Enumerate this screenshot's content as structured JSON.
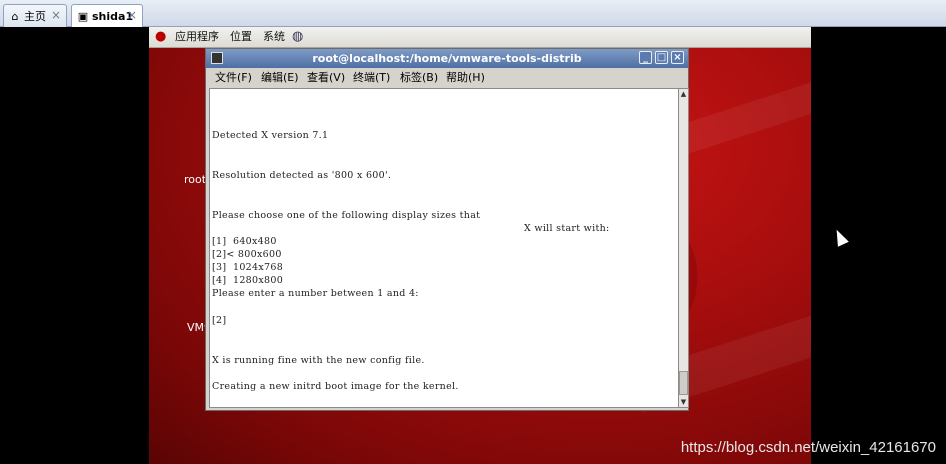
{
  "host_tabs": [
    {
      "label": "主页",
      "icon": "home-icon",
      "close": "×"
    },
    {
      "label": "shida1",
      "icon": "vm-icon",
      "close": "×"
    }
  ],
  "gnome_panel": {
    "items": [
      "应用程序",
      "位置",
      "系统"
    ],
    "logo_icon": "redhat-logo-icon",
    "network_icon": "globe-icon"
  },
  "desktop_labels": [
    "root",
    "VMw"
  ],
  "terminal": {
    "title": "root@localhost:/home/vmware-tools-distrib",
    "menu": [
      "文件(F)",
      "编辑(E)",
      "查看(V)",
      "终端(T)",
      "标签(B)",
      "帮助(H)"
    ],
    "lines": [
      "Detected X version 7.1",
      "Resolution detected as '800 x 600'.",
      "Please choose one of the following display sizes that",
      "X will start with:",
      "[1]  640x480",
      "[2]< 800x600",
      "[3]  1024x768",
      "[4]  1280x800",
      "Please enter a number between 1 and 4:",
      "[2]",
      "X is running fine with the new config file.",
      "Creating a new initrd boot image for the kernel."
    ]
  },
  "watermark": "https://blog.csdn.net/weixin_42161670"
}
